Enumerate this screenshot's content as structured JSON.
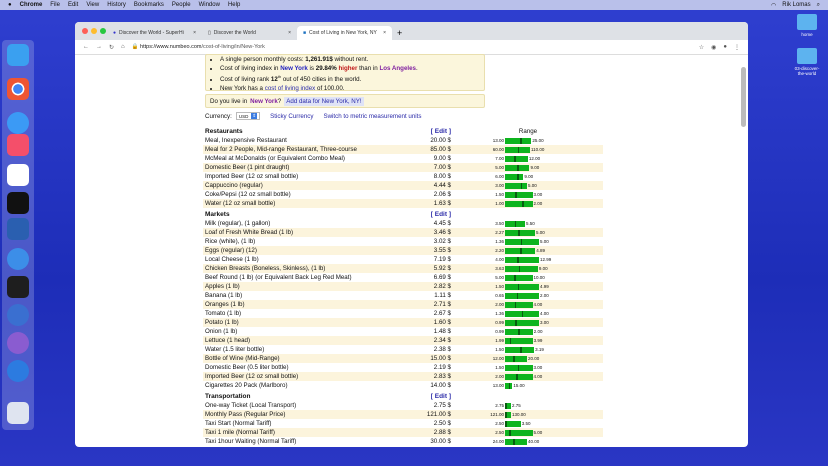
{
  "menubar": {
    "app": "Chrome",
    "items": [
      "File",
      "Edit",
      "View",
      "History",
      "Bookmarks",
      "People",
      "Window",
      "Help"
    ],
    "user": "Rik Lomas"
  },
  "desktop": {
    "items": [
      "home",
      "03-discover-the-world"
    ]
  },
  "browser": {
    "tabs": [
      {
        "label": "Discover the World - SuperHi"
      },
      {
        "label": "Discover the World"
      },
      {
        "label": "Cost of Living in New York, NY"
      }
    ],
    "url_host": "https://www.numbeo.com",
    "url_path": "/cost-of-living/in/New-York"
  },
  "summary": {
    "line1a": "A single person monthly costs: ",
    "line1b": "1,261.91$",
    "line1c": " without rent.",
    "line2a": "Cost of living index in ",
    "city": "New York",
    "line2b": " is ",
    "pct": "29.84%",
    "higher": "higher",
    "line2c": " than in ",
    "other": "Los Angeles",
    "line3a": "Cost of living rank ",
    "rank": "12",
    "sup": "th",
    "line3b": " out of 450 cities in the world.",
    "line4a": "New York has a ",
    "link": "cost of living index",
    "line4b": " of 100.00."
  },
  "live": {
    "q": "Do you live in ",
    "city": "New York",
    "qm": "?",
    "button": "Add data for New York, NY!"
  },
  "currency": {
    "label": "Currency:",
    "value": "USD",
    "sticky": "Sticky Currency",
    "metric": "Switch to metric measurement units"
  },
  "range_header": "Range",
  "edit_label": "[ Edit ]",
  "sections": [
    {
      "title": "Restaurants",
      "rows": [
        [
          "Meal, Inexpensive Restaurant",
          "20.00 $",
          "13.00",
          "25.00"
        ],
        [
          "Meal for 2 People, Mid-range Restaurant, Three-course",
          "85.00 $",
          "60.00",
          "110.00"
        ],
        [
          "McMeal at McDonalds (or Equivalent Combo Meal)",
          "9.00 $",
          "7.00",
          "12.00"
        ],
        [
          "Domestic Beer (1 pint draught)",
          "7.00 $",
          "5.00",
          "9.00"
        ],
        [
          "Imported Beer (12 oz small bottle)",
          "8.00 $",
          "6.00",
          "9.00"
        ],
        [
          "Cappuccino (regular)",
          "4.44 $",
          "3.00",
          "5.00"
        ],
        [
          "Coke/Pepsi (12 oz small bottle)",
          "2.06 $",
          "1.50",
          "3.00"
        ],
        [
          "Water (12 oz small bottle)",
          "1.63 $",
          "1.00",
          "2.00"
        ]
      ]
    },
    {
      "title": "Markets",
      "rows": [
        [
          "Milk (regular), (1 gallon)",
          "4.45 $",
          "3.50",
          "5.50"
        ],
        [
          "Loaf of Fresh White Bread (1 lb)",
          "3.46 $",
          "2.27",
          "5.00"
        ],
        [
          "Rice (white), (1 lb)",
          "3.02 $",
          "1.36",
          "5.00"
        ],
        [
          "Eggs (regular) (12)",
          "3.55 $",
          "2.20",
          "4.89"
        ],
        [
          "Local Cheese (1 lb)",
          "7.19 $",
          "4.00",
          "12.99"
        ],
        [
          "Chicken Breasts (Boneless, Skinless), (1 lb)",
          "5.92 $",
          "3.63",
          "9.00"
        ],
        [
          "Beef Round (1 lb) (or Equivalent Back Leg Red Meat)",
          "6.69 $",
          "5.00",
          "10.00"
        ],
        [
          "Apples (1 lb)",
          "2.82 $",
          "1.50",
          "4.99"
        ],
        [
          "Banana (1 lb)",
          "1.11 $",
          "0.65",
          "2.00"
        ],
        [
          "Oranges (1 lb)",
          "2.71 $",
          "2.00",
          "4.00"
        ],
        [
          "Tomato (1 lb)",
          "2.67 $",
          "1.36",
          "4.00"
        ],
        [
          "Potato (1 lb)",
          "1.60 $",
          "0.99",
          "3.00"
        ],
        [
          "Onion (1 lb)",
          "1.48 $",
          "0.99",
          "2.00"
        ],
        [
          "Lettuce (1 head)",
          "2.34 $",
          "1.99",
          "3.99"
        ],
        [
          "Water (1.5 liter bottle)",
          "2.38 $",
          "1.50",
          "3.19"
        ],
        [
          "Bottle of Wine (Mid-Range)",
          "15.00 $",
          "12.00",
          "20.00"
        ],
        [
          "Domestic Beer (0.5 liter bottle)",
          "2.19 $",
          "1.50",
          "3.00"
        ],
        [
          "Imported Beer (12 oz small bottle)",
          "2.83 $",
          "2.00",
          "4.00"
        ],
        [
          "Cigarettes 20 Pack (Marlboro)",
          "14.00 $",
          "13.00",
          "15.00"
        ]
      ]
    },
    {
      "title": "Transportation",
      "rows": [
        [
          "One-way Ticket (Local Transport)",
          "2.75 $",
          "2.75",
          "2.75"
        ],
        [
          "Monthly Pass (Regular Price)",
          "121.00 $",
          "121.00",
          "130.00"
        ],
        [
          "Taxi Start (Normal Tariff)",
          "2.50 $",
          "2.50",
          "3.50"
        ],
        [
          "Taxi 1 mile (Normal Tariff)",
          "2.88 $",
          "2.50",
          "5.00"
        ],
        [
          "Taxi 1hour Waiting (Normal Tariff)",
          "30.00 $",
          "24.00",
          "40.00"
        ]
      ]
    }
  ],
  "colors": {
    "bar": "#0eb41e",
    "alt_row": "#fcf4dc",
    "link": "#2a2aa8"
  }
}
